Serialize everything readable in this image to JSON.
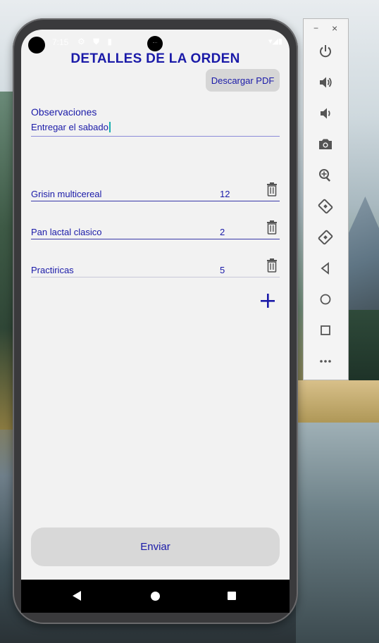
{
  "status_bar": {
    "time": "7:15",
    "icons": "⚙ ⛊ ▮",
    "right_icons": "▾◢▮"
  },
  "screen": {
    "title": "DETALLES DE LA ORDEN",
    "pdf_button_label": "Descargar PDF",
    "observations_label": "Observaciones",
    "observations_value": "Entregar el sabado",
    "items": [
      {
        "name": "Grisin multicereal",
        "qty": "12"
      },
      {
        "name": "Pan lactal clasico",
        "qty": "2"
      },
      {
        "name": "Practiricas",
        "qty": "5"
      }
    ],
    "send_button_label": "Enviar"
  },
  "emulator_panel": {
    "minimize_label": "−",
    "close_label": "×",
    "buttons": [
      "power-icon",
      "volume-up-icon",
      "volume-down-icon",
      "camera-icon",
      "zoom-icon",
      "rotate-left-icon",
      "rotate-right-icon",
      "back-icon",
      "home-icon",
      "overview-icon",
      "more-icon"
    ]
  },
  "colors": {
    "accent": "#1a1aa8",
    "screen_bg": "#f2f2f2",
    "button_bg": "#d6d6d6"
  }
}
